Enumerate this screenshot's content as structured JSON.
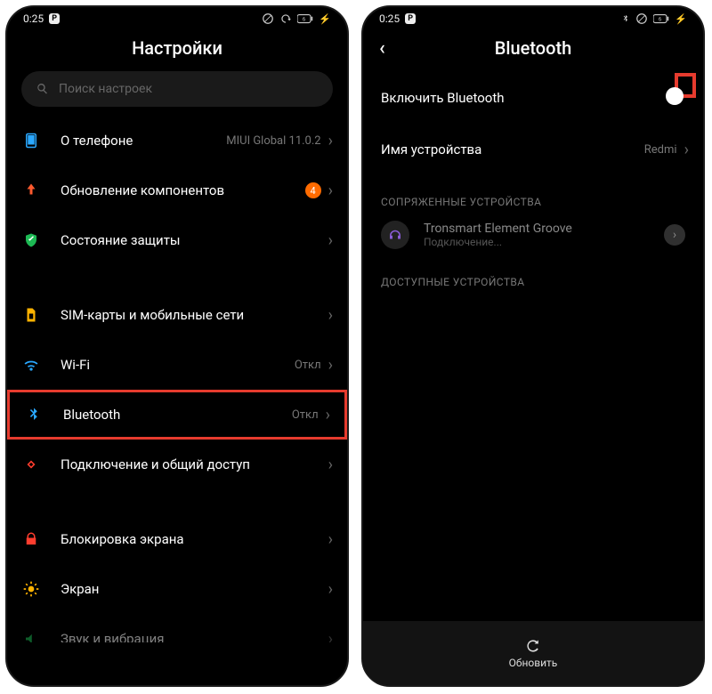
{
  "statusbar": {
    "time": "0:25"
  },
  "left": {
    "title": "Настройки",
    "search_placeholder": "Поиск настроек",
    "items": [
      {
        "id": "about",
        "label": "О телефоне",
        "value": "MIUI Global 11.0.2"
      },
      {
        "id": "updates",
        "label": "Обновление компонентов",
        "badge": "4"
      },
      {
        "id": "security",
        "label": "Состояние защиты"
      }
    ],
    "items2": [
      {
        "id": "sim",
        "label": "SIM-карты и мобильные сети"
      },
      {
        "id": "wifi",
        "label": "Wi-Fi",
        "value": "Откл"
      },
      {
        "id": "bluetooth",
        "label": "Bluetooth",
        "value": "Откл"
      },
      {
        "id": "tether",
        "label": "Подключение и общий доступ"
      }
    ],
    "items3": [
      {
        "id": "lock",
        "label": "Блокировка экрана"
      },
      {
        "id": "display",
        "label": "Экран"
      },
      {
        "id": "sound",
        "label": "Звук и вибрация"
      }
    ]
  },
  "right": {
    "title": "Bluetooth",
    "rows": {
      "enable": {
        "label": "Включить Bluetooth",
        "on": true
      },
      "name": {
        "label": "Имя устройства",
        "value": "Redmi"
      }
    },
    "section_paired": "СОПРЯЖЕННЫЕ УСТРОЙСТВА",
    "paired": {
      "name": "Tronsmart Element Groove",
      "sub": "Подключение..."
    },
    "section_available": "ДОСТУПНЫЕ УСТРОЙСТВА",
    "refresh_label": "Обновить"
  }
}
